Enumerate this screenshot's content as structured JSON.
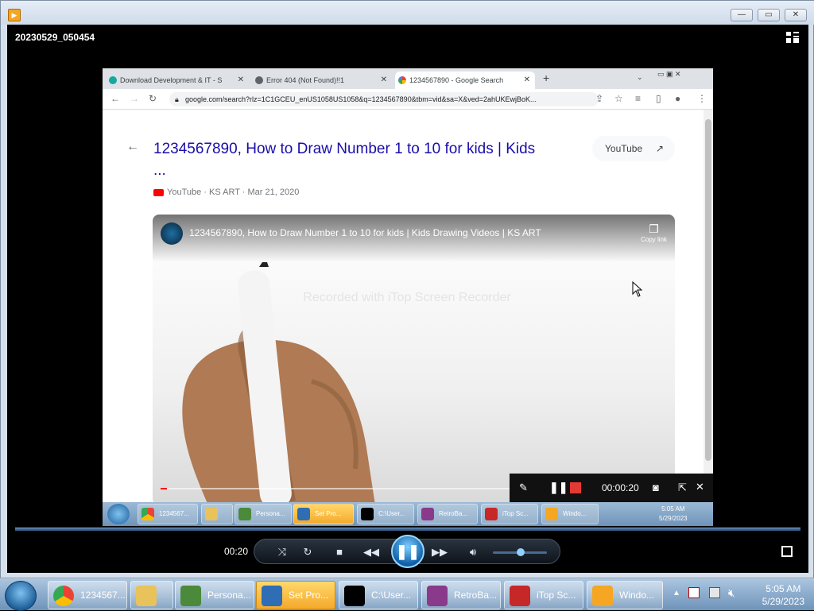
{
  "window": {
    "minimize": "—",
    "restore": "▭",
    "close": "✕"
  },
  "player": {
    "file_name": "20230529_050454",
    "time": "00:20"
  },
  "browser": {
    "tabs": [
      {
        "label": "Download Development & IT - S",
        "close": "✕"
      },
      {
        "label": "Error 404 (Not Found)!!1",
        "close": "✕"
      },
      {
        "label": "1234567890 - Google Search",
        "close": "✕"
      }
    ],
    "new_tab": "+",
    "url": "google.com/search?rlz=1C1GCEU_enUS1058US1058&q=1234567890&tbm=vid&sa=X&ved=2ahUKEwjBoK..."
  },
  "result": {
    "title": "1234567890, How to Draw Number 1 to 10 for kids | Kids ...",
    "source": "YouTube · KS ART · Mar 21, 2020",
    "youtube_button": "YouTube"
  },
  "video": {
    "title": "1234567890, How to Draw Number 1 to 10 for kids | Kids Drawing Videos | KS ART",
    "copy_link": "Copy link",
    "watermark": "Recorded with iTop Screen Recorder"
  },
  "recorder": {
    "elapsed": "00:00:20"
  },
  "inner_taskbar": {
    "items": [
      "1234567...",
      "",
      "Persona...",
      "Set Pro...",
      "C:\\User...",
      "RetroBa...",
      "iTop Sc...",
      "Windo..."
    ],
    "time": "5:05 AM",
    "date": "5/29/2023"
  },
  "taskbar": {
    "items": [
      "1234567...",
      "",
      "Persona...",
      "Set Pro...",
      "C:\\User...",
      "RetroBa...",
      "iTop Sc...",
      "Windo..."
    ],
    "time": "5:05 AM",
    "date": "5/29/2023"
  }
}
